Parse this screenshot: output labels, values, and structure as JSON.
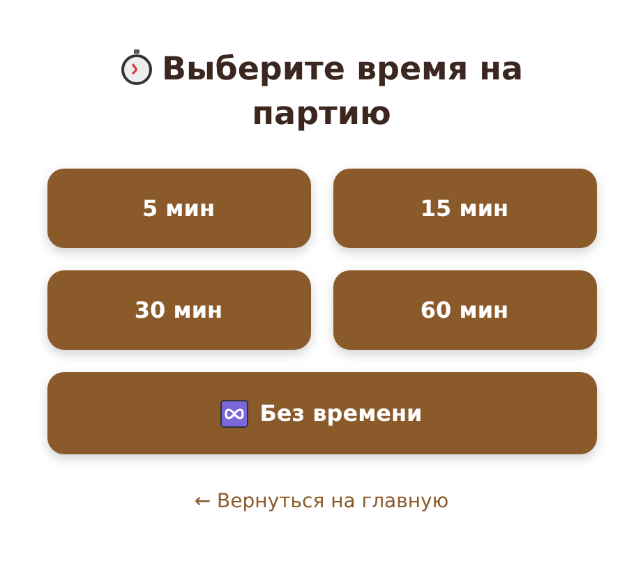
{
  "title": "Выберите время на партию",
  "options": [
    {
      "label": "5 мин",
      "kind": "duration"
    },
    {
      "label": "15 мин",
      "kind": "duration"
    },
    {
      "label": "30 мин",
      "kind": "duration"
    },
    {
      "label": "60 мин",
      "kind": "duration"
    },
    {
      "label": "Без времени",
      "kind": "unlimited"
    }
  ],
  "back_link": "← Вернуться на главную"
}
